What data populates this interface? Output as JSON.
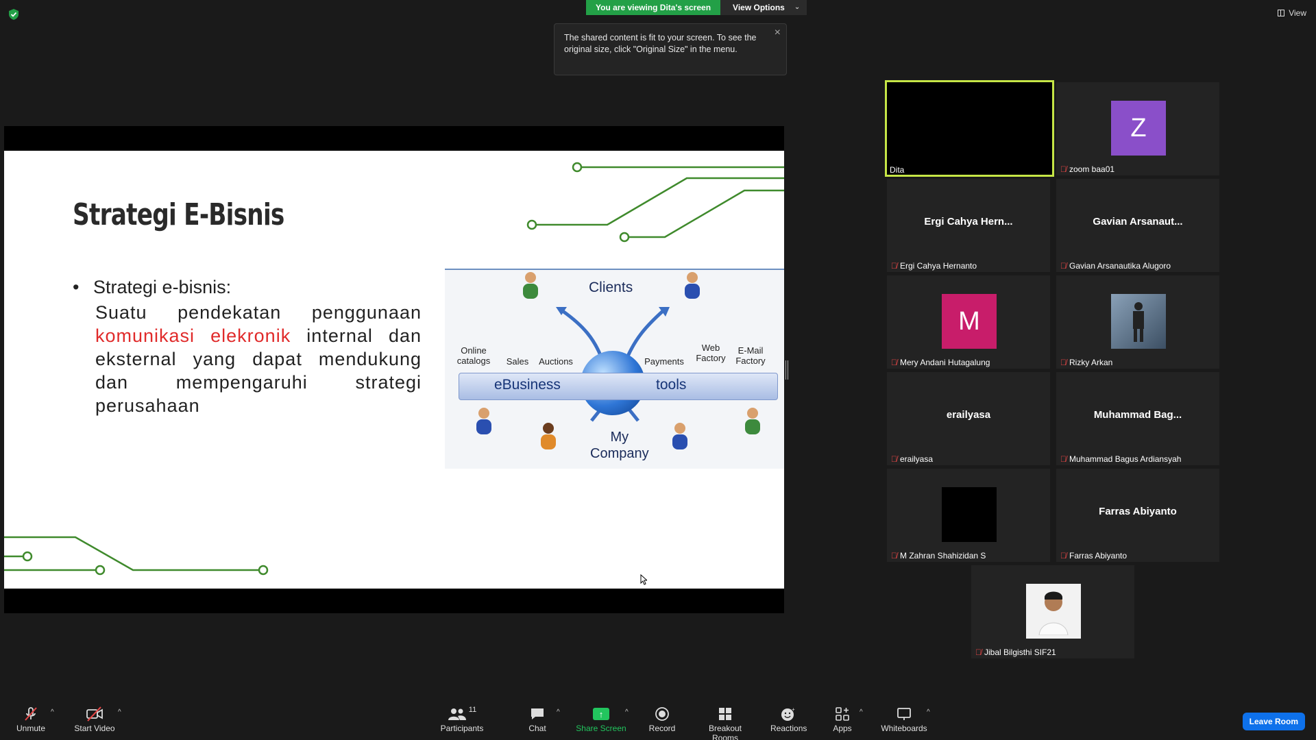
{
  "top": {
    "viewing_label": "You are viewing Dita's screen",
    "view_options": "View Options",
    "view_btn": "View",
    "tooltip": "The shared content is fit to your screen. To see the original size, click \"Original Size\" in the menu."
  },
  "slide": {
    "title": "Strategi E-Bisnis",
    "bullet_head": "Strategi e-bisnis:",
    "body_pre": "Suatu pendekatan penggunaan ",
    "body_highlight": "komunikasi elekronik",
    "body_post": " internal dan eksternal yang dapat mendukung dan mempengaruhi strategi perusahaan",
    "diagram": {
      "clients": "Clients",
      "company_line1": "My",
      "company_line2": "Company",
      "bar_left": "eBusiness",
      "bar_right": "tools",
      "labels": [
        "Online catalogs",
        "Sales",
        "Auctions",
        "Payments",
        "Web Factory",
        "E-Mail Factory"
      ]
    }
  },
  "participants": [
    {
      "name": "Dita",
      "center": "",
      "avatar": "",
      "color": "",
      "active": true
    },
    {
      "name": "zoom baa01",
      "center": "",
      "avatar": "Z",
      "color": "#8a4fc9"
    },
    {
      "name": "Ergi Cahya Hernanto",
      "center": "Ergi Cahya Hern...",
      "avatar": "",
      "color": ""
    },
    {
      "name": "Gavian Arsanautika Alugoro",
      "center": "Gavian  Arsanaut...",
      "avatar": "",
      "color": ""
    },
    {
      "name": "Mery Andani Hutagalung",
      "center": "",
      "avatar": "M",
      "color": "#c81d6a"
    },
    {
      "name": "Rizky Arkan",
      "center": "",
      "avatar": "",
      "color": "#5a6f86"
    },
    {
      "name": "erailyasa",
      "center": "erailyasa",
      "avatar": "",
      "color": ""
    },
    {
      "name": "Muhammad Bagus Ardiansyah",
      "center": "Muhammad  Bag...",
      "avatar": "",
      "color": ""
    },
    {
      "name": "M Zahran Shahizidan S",
      "center": "",
      "avatar": "",
      "color": "#000000"
    },
    {
      "name": "Farras Abiyanto",
      "center": "Farras Abiyanto",
      "avatar": "",
      "color": ""
    },
    {
      "name": "Jibal Bilgisthi SIF21",
      "center": "",
      "avatar": "",
      "color": "#ffffff"
    }
  ],
  "toolbar": {
    "unmute": "Unmute",
    "start_video": "Start Video",
    "participants": "Participants",
    "participants_count": "11",
    "chat": "Chat",
    "share_screen": "Share Screen",
    "record": "Record",
    "breakout": "Breakout Rooms",
    "reactions": "Reactions",
    "apps": "Apps",
    "whiteboards": "Whiteboards",
    "leave": "Leave Room"
  }
}
